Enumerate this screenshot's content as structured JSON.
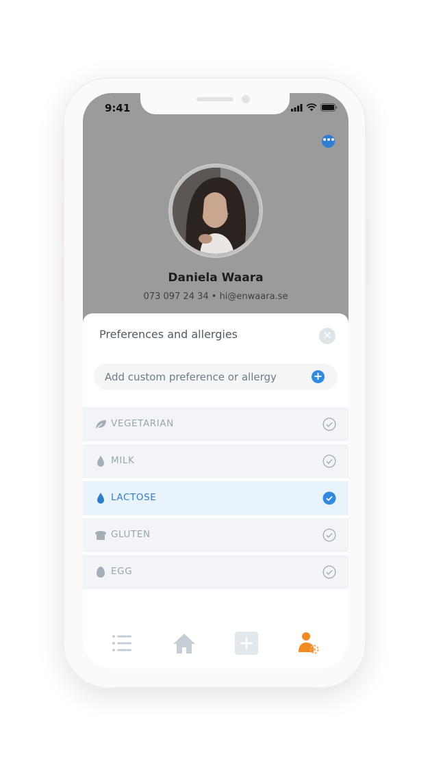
{
  "status_bar": {
    "time": "9:41"
  },
  "profile": {
    "name": "Daniela Waara",
    "contact": "073 097 24 34 • hi@enwaara.se"
  },
  "sheet": {
    "title": "Preferences and allergies",
    "add_placeholder": "Add custom preference or allergy"
  },
  "preferences": [
    {
      "label": "VEGETARIAN",
      "icon": "leaf-icon",
      "selected": false
    },
    {
      "label": "MILK",
      "icon": "drop-icon",
      "selected": false
    },
    {
      "label": "LACTOSE",
      "icon": "drop-icon",
      "selected": true
    },
    {
      "label": "GLUTEN",
      "icon": "bread-icon",
      "selected": false
    },
    {
      "label": "EGG",
      "icon": "egg-icon",
      "selected": false
    }
  ],
  "tabbar": {
    "tabs": [
      {
        "icon": "list-icon",
        "active": false
      },
      {
        "icon": "home-icon",
        "active": false
      },
      {
        "icon": "add-icon",
        "active": false
      },
      {
        "icon": "profile-settings-icon",
        "active": true
      }
    ]
  },
  "colors": {
    "accent": "#2f8ae0",
    "active_tab": "#f08a24",
    "inactive_icon": "#c5ced6",
    "selected_row": "#e8f3fb"
  }
}
